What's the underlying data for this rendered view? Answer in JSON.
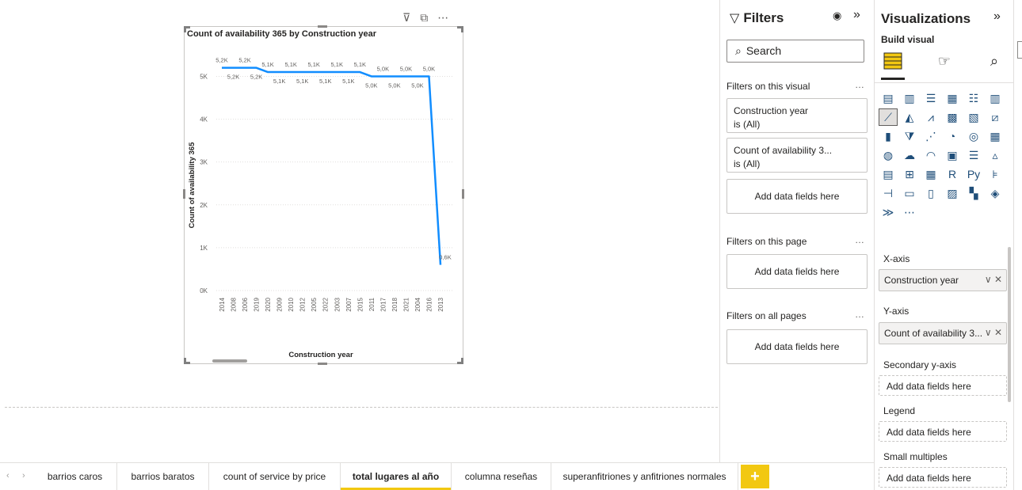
{
  "visual": {
    "header_icons": {
      "filter": "⊽",
      "focus": "⧉",
      "more": "⋯"
    }
  },
  "chart_data": {
    "type": "line",
    "title": "Count of availability 365 by Construction year",
    "xlabel": "Construction year",
    "ylabel": "Count of availability 365",
    "categories": [
      "2014",
      "2008",
      "2006",
      "2019",
      "2020",
      "2009",
      "2010",
      "2012",
      "2005",
      "2022",
      "2003",
      "2007",
      "2015",
      "2011",
      "2017",
      "2018",
      "2021",
      "2004",
      "2016",
      "2013"
    ],
    "values": [
      5200,
      5200,
      5200,
      5200,
      5100,
      5100,
      5100,
      5100,
      5100,
      5100,
      5100,
      5100,
      5100,
      5000,
      5000,
      5000,
      5000,
      5000,
      5000,
      600
    ],
    "data_labels": [
      "5,2K",
      "5,2K",
      "5,2K",
      "5,2K",
      "5,1K",
      "5,1K",
      "5,1K",
      "5,1K",
      "5,1K",
      "5,1K",
      "5,1K",
      "5,1K",
      "5,1K",
      "5,0K",
      "5,0K",
      "5,0K",
      "5,0K",
      "5,0K",
      "5,0K",
      "0,6K"
    ],
    "yticks": [
      "0K",
      "1K",
      "2K",
      "3K",
      "4K",
      "5K"
    ],
    "ylim": [
      0,
      5600
    ],
    "line_color": "#118dff",
    "grid": true,
    "legend": "none"
  },
  "filters": {
    "title": "Filters",
    "search_placeholder": "Search",
    "on_visual_label": "Filters on this visual",
    "on_page_label": "Filters on this page",
    "on_all_pages_label": "Filters on all pages",
    "more": "…",
    "cards": [
      {
        "field": "Construction year",
        "state": "is (All)"
      },
      {
        "field": "Count of availability 3...",
        "state": "is (All)"
      }
    ],
    "add_fields": "Add data fields here"
  },
  "viz": {
    "title": "Visualizations",
    "build_visual": "Build visual",
    "x_axis_label": "X-axis",
    "x_axis_field": "Construction year",
    "y_axis_label": "Y-axis",
    "y_axis_field": "Count of availability 3...",
    "secondary_label": "Secondary y-axis",
    "legend_label": "Legend",
    "small_multiples_label": "Small multiples",
    "add_fields": "Add data fields here",
    "field_actions": "∨ ✕",
    "icons": [
      "▤",
      "▥",
      "☰",
      "▦",
      "☷",
      "▥",
      "⟋",
      "◭",
      "⩘",
      "▩",
      "▧",
      "⧄",
      "▮",
      "⧩",
      "⋰",
      "◔",
      "◎",
      "▦",
      "◍",
      "☁",
      "◠",
      "▣",
      "☰",
      "▵",
      "▤",
      "⊞",
      "▦",
      "R",
      "Py",
      "⊧",
      "⊣",
      "▭",
      "▯",
      "▨",
      "▚",
      "◈",
      "≫",
      "⋯"
    ]
  },
  "tabs": [
    {
      "label": "barrios caros"
    },
    {
      "label": "barrios baratos"
    },
    {
      "label": "count of service by price"
    },
    {
      "label": "total lugares al año"
    },
    {
      "label": "columna reseñas"
    },
    {
      "label": "superanfitriones y anfitriones normales"
    }
  ],
  "active_tab": "total lugares al año",
  "add_page": "+"
}
